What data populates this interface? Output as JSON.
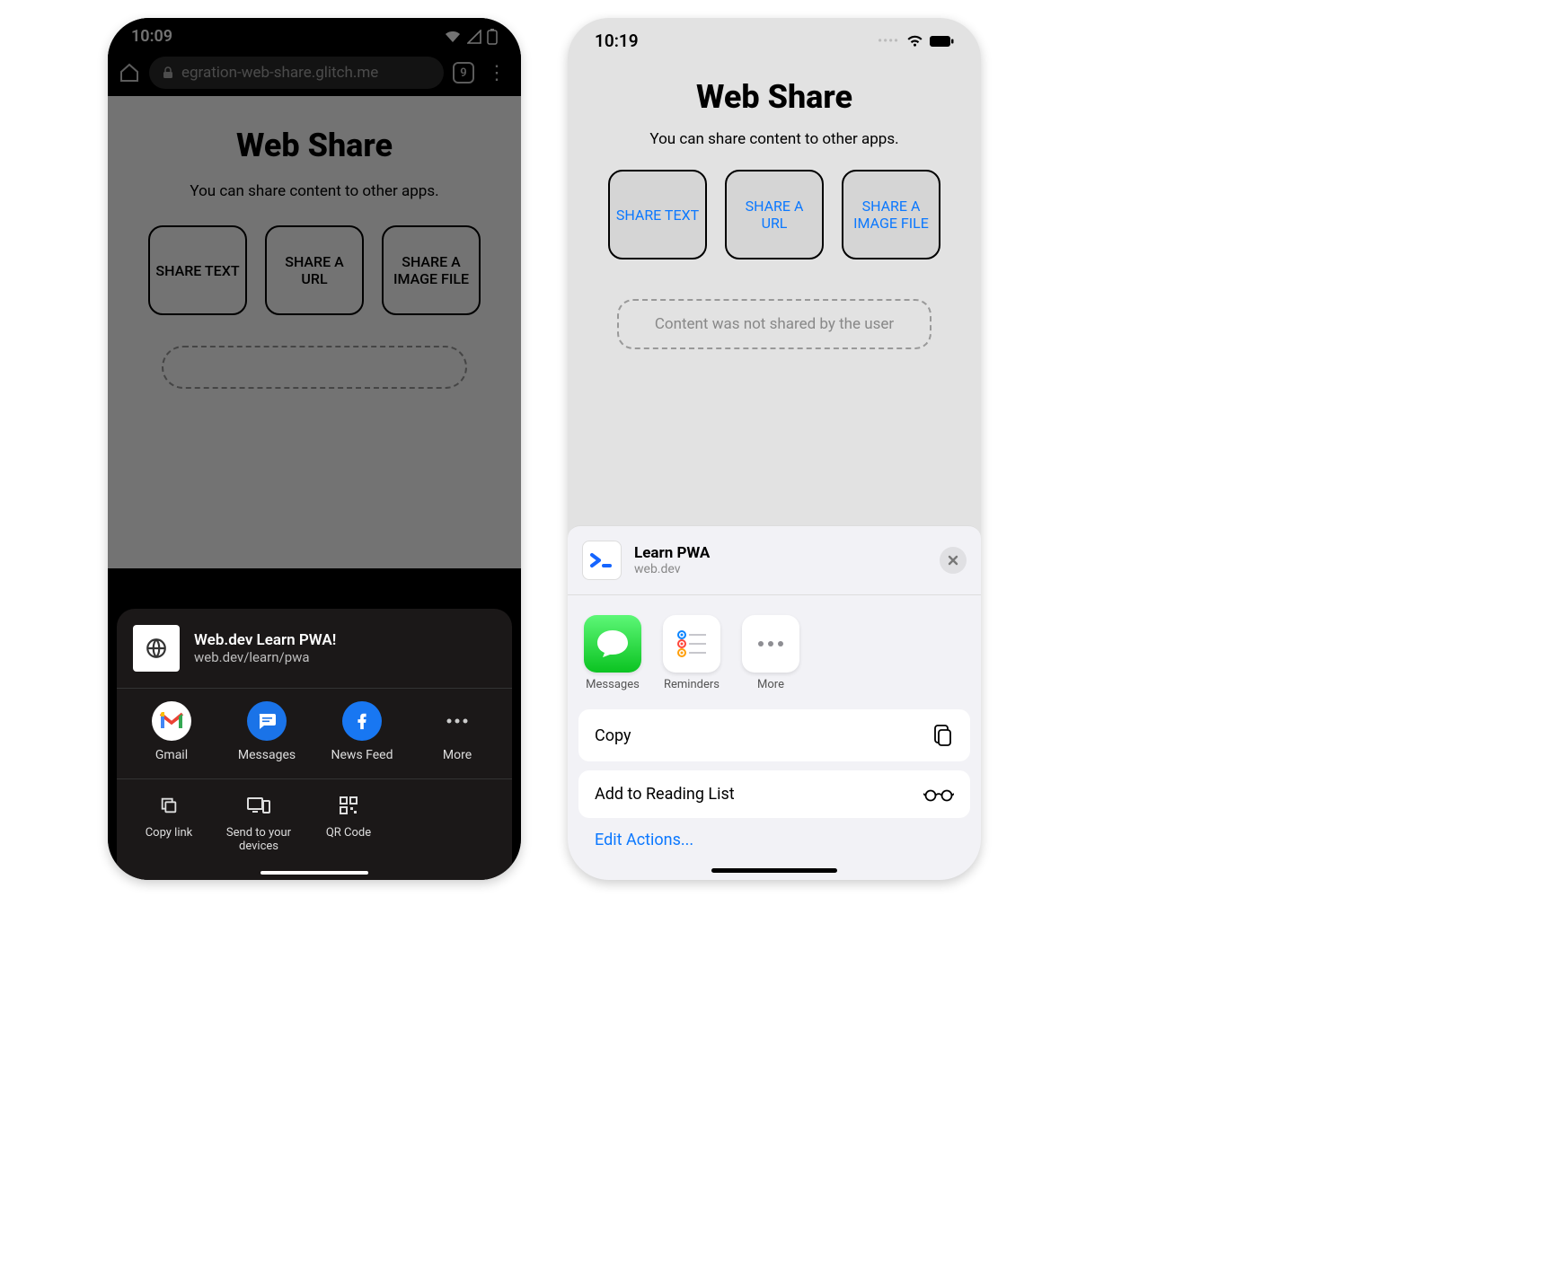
{
  "android": {
    "time": "10:09",
    "tab_count": "9",
    "address": "egration-web-share.glitch.me",
    "page": {
      "heading": "Web Share",
      "sub": "You can share content to other apps.",
      "buttons": [
        "SHARE TEXT",
        "SHARE A URL",
        "SHARE A IMAGE FILE"
      ]
    },
    "sheet": {
      "title": "Web.dev Learn PWA!",
      "url": "web.dev/learn/pwa",
      "apps": [
        "Gmail",
        "Messages",
        "News Feed",
        "More"
      ],
      "actions": [
        "Copy link",
        "Send to your devices",
        "QR Code"
      ]
    }
  },
  "ios": {
    "time": "10:19",
    "page": {
      "heading": "Web Share",
      "sub": "You can share content to other apps.",
      "buttons": [
        "SHARE TEXT",
        "SHARE A URL",
        "SHARE A IMAGE FILE"
      ],
      "status": "Content was not shared by the user"
    },
    "sheet": {
      "title": "Learn PWA",
      "url": "web.dev",
      "apps": [
        "Messages",
        "Reminders",
        "More"
      ],
      "actions": [
        "Copy",
        "Add to Reading List"
      ],
      "edit": "Edit Actions..."
    }
  }
}
